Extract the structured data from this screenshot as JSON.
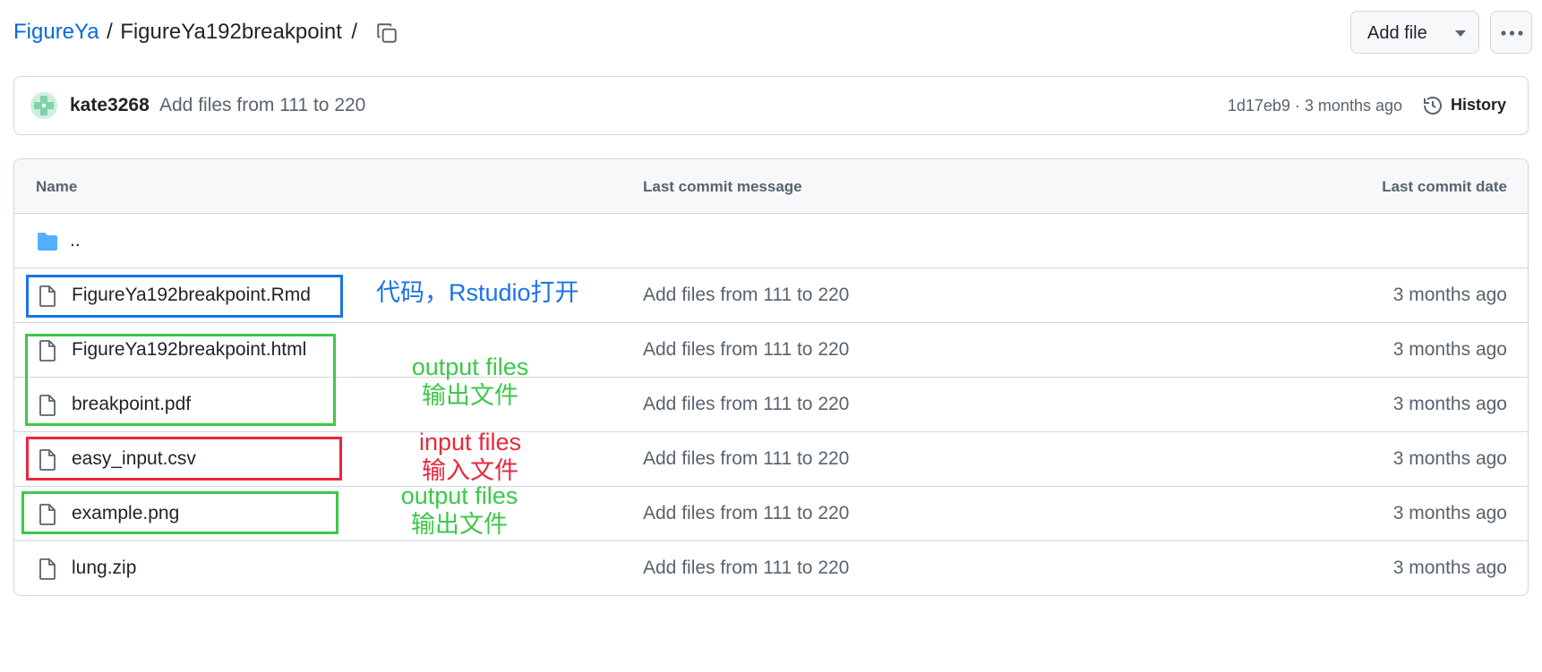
{
  "breadcrumb": {
    "repo": "FigureYa",
    "sep1": "/",
    "folder": "FigureYa192breakpoint",
    "sep2": "/"
  },
  "actions": {
    "add_file": "Add file",
    "more_icon": "kebab-horizontal-icon"
  },
  "commit": {
    "author": "kate3268",
    "message": "Add files from 111 to 220",
    "sha_time": "1d17eb9 · 3 months ago",
    "history": "History"
  },
  "table": {
    "headers": {
      "name": "Name",
      "message": "Last commit message",
      "date": "Last commit date"
    },
    "parent": "..",
    "files": [
      {
        "name": "FigureYa192breakpoint.Rmd",
        "message": "Add files from 111 to 220",
        "date": "3 months ago"
      },
      {
        "name": "FigureYa192breakpoint.html",
        "message": "Add files from 111 to 220",
        "date": "3 months ago"
      },
      {
        "name": "breakpoint.pdf",
        "message": "Add files from 111 to 220",
        "date": "3 months ago"
      },
      {
        "name": "easy_input.csv",
        "message": "Add files from 111 to 220",
        "date": "3 months ago"
      },
      {
        "name": "example.png",
        "message": "Add files from 111 to 220",
        "date": "3 months ago"
      },
      {
        "name": "lung.zip",
        "message": "Add files from 111 to 220",
        "date": "3 months ago"
      }
    ]
  },
  "annotations": {
    "code": "代码，Rstudio打开",
    "output1_en": "output files",
    "output1_zh": "输出文件",
    "input_en": "input files",
    "input_zh": "输入文件",
    "output2_en": "output files",
    "output2_zh": "输出文件",
    "colors": {
      "blue": "#1a73e8",
      "green": "#3cc84a",
      "red": "#e8283c"
    }
  }
}
